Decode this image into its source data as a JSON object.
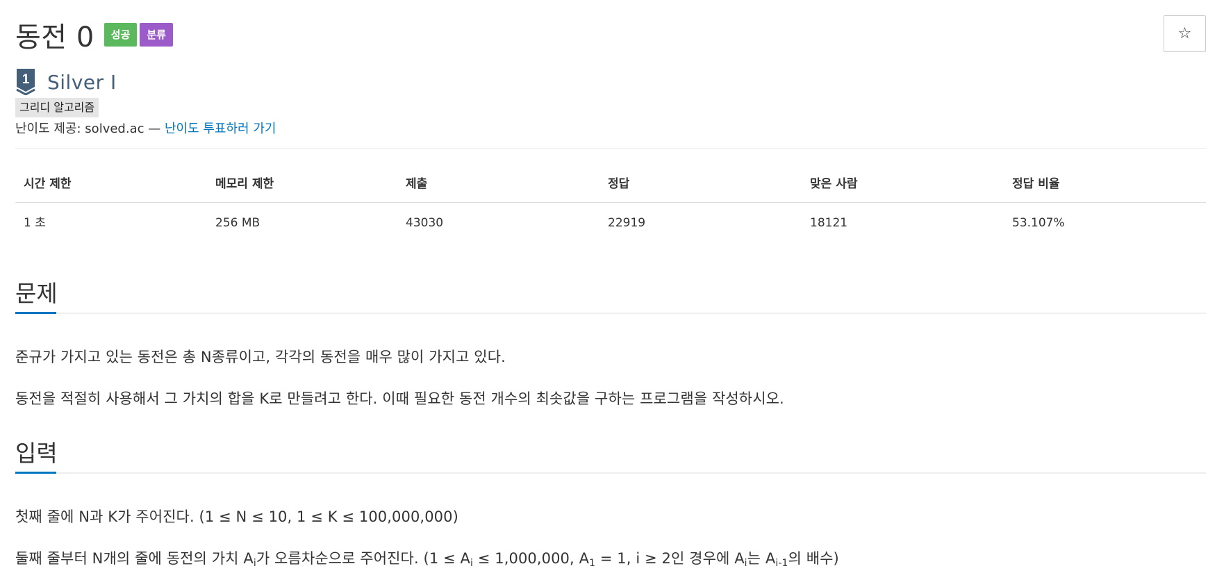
{
  "problem": {
    "title": "동전 0",
    "labels": {
      "success": "성공",
      "classify": "분류"
    },
    "star_icon": "☆",
    "tier": {
      "number": "1",
      "name": "Silver I"
    },
    "tag": "그리디 알고리즘",
    "provider": {
      "prefix": "난이도 제공: solved.ac — ",
      "link": "난이도 투표하러 가기"
    }
  },
  "stats": {
    "headers": [
      "시간 제한",
      "메모리 제한",
      "제출",
      "정답",
      "맞은 사람",
      "정답 비율"
    ],
    "values": [
      "1 초",
      "256 MB",
      "43030",
      "22919",
      "18121",
      "53.107%"
    ]
  },
  "sections": {
    "problem_title": "문제",
    "problem_lines": [
      "준규가 가지고 있는 동전은 총 N종류이고, 각각의 동전을 매우 많이 가지고 있다.",
      "동전을 적절히 사용해서 그 가치의 합을 K로 만들려고 한다. 이때 필요한 동전 개수의 최솟값을 구하는 프로그램을 작성하시오."
    ],
    "input_title": "입력",
    "input_line1": "첫째 줄에 N과 K가 주어진다. (1 ≤ N ≤ 10, 1 ≤ K ≤ 100,000,000)",
    "input_line2": {
      "p1": "둘째 줄부터 N개의 줄에 동전의 가치 A",
      "s1": "i",
      "p2": "가 오름차순으로 주어진다. (1 ≤ A",
      "s2": "i",
      "p3": " ≤ 1,000,000, A",
      "s3": "1",
      "p4": " = 1, i ≥ 2인 경우에 A",
      "s4": "i",
      "p5": "는 A",
      "s5": "i-1",
      "p6": "의 배수)"
    }
  }
}
